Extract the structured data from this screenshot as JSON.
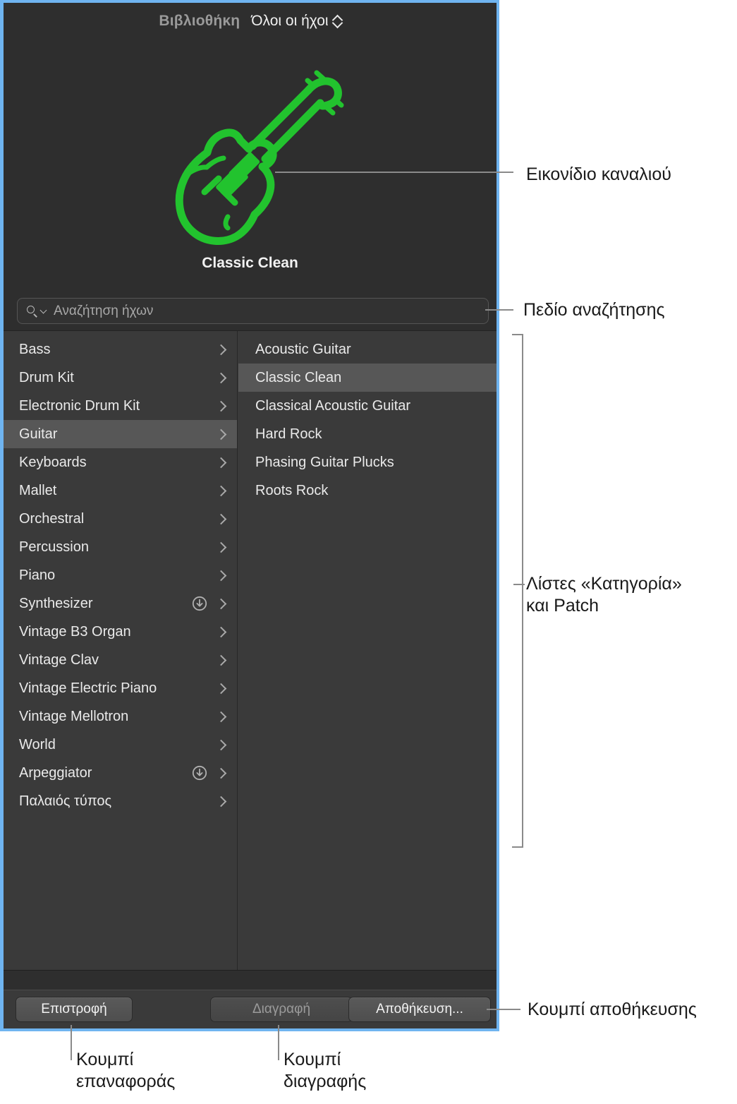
{
  "window": {
    "accent_border": "#6fb4f0",
    "panel_bg": "#2e2e2e",
    "list_bg": "#3a3a3a",
    "selection_bg": "#575757",
    "icon_color": "#22c32e"
  },
  "header": {
    "library_label": "Βιβλιοθήκη",
    "sound_filter": "Όλοι οι ήχοι",
    "sort_icon": "up-down-chevron-icon"
  },
  "channel_icon": {
    "name": "guitar-icon",
    "color": "#22c32e"
  },
  "patch_title": "Classic Clean",
  "search": {
    "placeholder": "Αναζήτηση ήχων",
    "value": "",
    "icon": "search-icon",
    "menu_icon": "chevron-down-icon"
  },
  "categories": [
    {
      "label": "Bass",
      "selected": false,
      "download": false
    },
    {
      "label": "Drum Kit",
      "selected": false,
      "download": false
    },
    {
      "label": "Electronic Drum Kit",
      "selected": false,
      "download": false
    },
    {
      "label": "Guitar",
      "selected": true,
      "download": false
    },
    {
      "label": "Keyboards",
      "selected": false,
      "download": false
    },
    {
      "label": "Mallet",
      "selected": false,
      "download": false
    },
    {
      "label": "Orchestral",
      "selected": false,
      "download": false
    },
    {
      "label": "Percussion",
      "selected": false,
      "download": false
    },
    {
      "label": "Piano",
      "selected": false,
      "download": false
    },
    {
      "label": "Synthesizer",
      "selected": false,
      "download": true
    },
    {
      "label": "Vintage B3 Organ",
      "selected": false,
      "download": false
    },
    {
      "label": "Vintage Clav",
      "selected": false,
      "download": false
    },
    {
      "label": "Vintage Electric Piano",
      "selected": false,
      "download": false
    },
    {
      "label": "Vintage Mellotron",
      "selected": false,
      "download": false
    },
    {
      "label": "World",
      "selected": false,
      "download": false
    },
    {
      "label": "Arpeggiator",
      "selected": false,
      "download": true
    },
    {
      "label": "Παλαιός τύπος",
      "selected": false,
      "download": false
    }
  ],
  "patches": [
    {
      "label": "Acoustic Guitar",
      "selected": false
    },
    {
      "label": "Classic Clean",
      "selected": true
    },
    {
      "label": "Classical Acoustic Guitar",
      "selected": false
    },
    {
      "label": "Hard Rock",
      "selected": false
    },
    {
      "label": "Phasing Guitar Plucks",
      "selected": false
    },
    {
      "label": "Roots Rock",
      "selected": false
    }
  ],
  "buttons": {
    "revert": "Επιστροφή",
    "delete": "Διαγραφή",
    "save": "Αποθήκευση..."
  },
  "callouts": {
    "channel_icon": "Εικονίδιο καναλιού",
    "search_field": "Πεδίο αναζήτησης",
    "lists": "Λίστες «Κατηγορία»\nκαι Patch",
    "save_button": "Κουμπί αποθήκευσης",
    "revert_button": "Κουμπί\nεπαναφοράς",
    "delete_button": "Κουμπί\nδιαγραφής"
  }
}
